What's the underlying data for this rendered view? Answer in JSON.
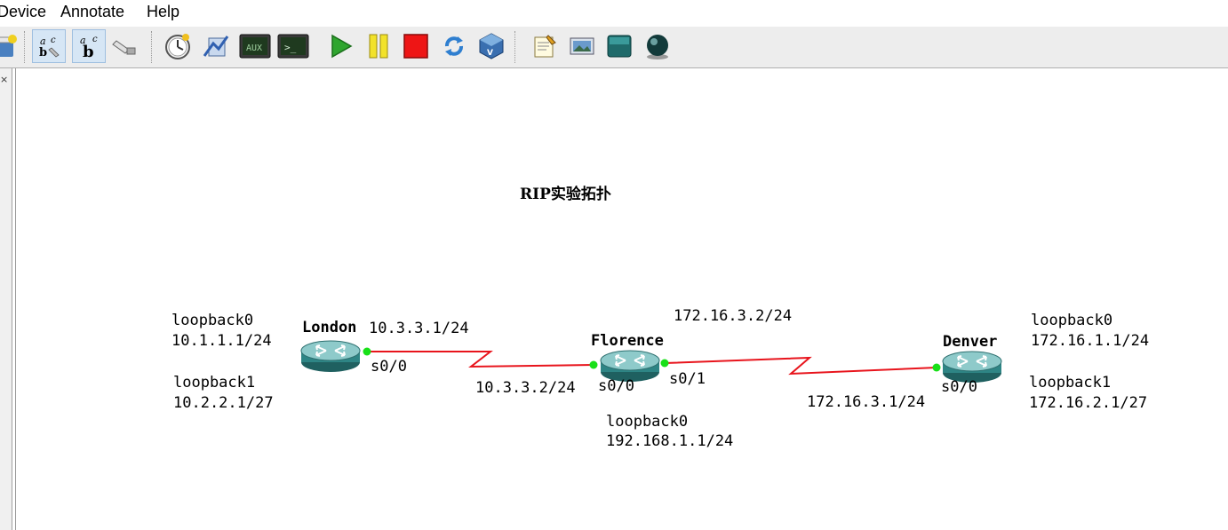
{
  "menu": {
    "device": "Device",
    "annotate": "Annotate",
    "help": "Help"
  },
  "toolbar": {
    "aux_label": "AUX",
    "console_label": ">_",
    "text_ab": "ab"
  },
  "left_panel": {
    "close_glyph": "×"
  },
  "topology": {
    "title": "RIP实验拓扑",
    "routers": {
      "london": {
        "name": "London",
        "s0_0_ip": "10.3.3.1/24",
        "s0_0_port": "s0/0",
        "loopback0_label": "loopback0",
        "loopback0_ip": "10.1.1.1/24",
        "loopback1_label": "loopback1",
        "loopback1_ip": "10.2.2.1/27"
      },
      "florence": {
        "name": "Florence",
        "s0_0_ip": "10.3.3.2/24",
        "s0_0_port": "s0/0",
        "s0_1_ip": "172.16.3.2/24",
        "s0_1_port": "s0/1",
        "loopback0_label": "loopback0",
        "loopback0_ip": "192.168.1.1/24"
      },
      "denver": {
        "name": "Denver",
        "s0_0_ip": "172.16.3.1/24",
        "s0_0_port": "s0/0",
        "loopback0_label": "loopback0",
        "loopback0_ip": "172.16.1.1/24",
        "loopback1_label": "loopback1",
        "loopback1_ip": "172.16.2.1/27"
      }
    },
    "colors": {
      "link": "#e8141c",
      "port_up": "#18e018",
      "router_body": "#2e8585",
      "router_top": "#8ecaca"
    }
  }
}
